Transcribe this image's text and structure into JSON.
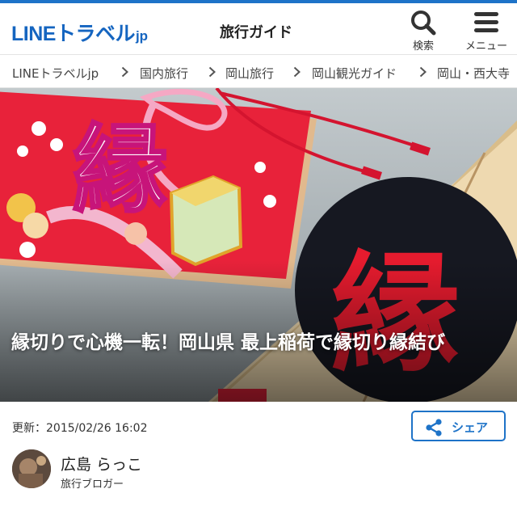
{
  "header": {
    "logo_main": "LINEトラベル",
    "logo_suffix": "jp",
    "title": "旅行ガイド",
    "search_label": "検索",
    "menu_label": "メニュー",
    "search_icon": "search-icon",
    "menu_icon": "hamburger-icon"
  },
  "breadcrumb": [
    "LINEトラベルjp",
    "国内旅行",
    "岡山旅行",
    "岡山観光ガイド",
    "岡山・西大寺"
  ],
  "article": {
    "title": "縁切りで心機一転！岡山県 最上稲荷で縁切り縁結び",
    "hero_text": "縁",
    "updated": "更新：2015/02/26 16:02",
    "share_label": "シェア",
    "share_icon": "share-icon"
  },
  "author": {
    "name": "広島 らっこ",
    "role": "旅行ブロガー"
  },
  "colors": {
    "accent": "#1e73c8",
    "logo": "#1565c0",
    "ema_red": "#e8223a"
  }
}
